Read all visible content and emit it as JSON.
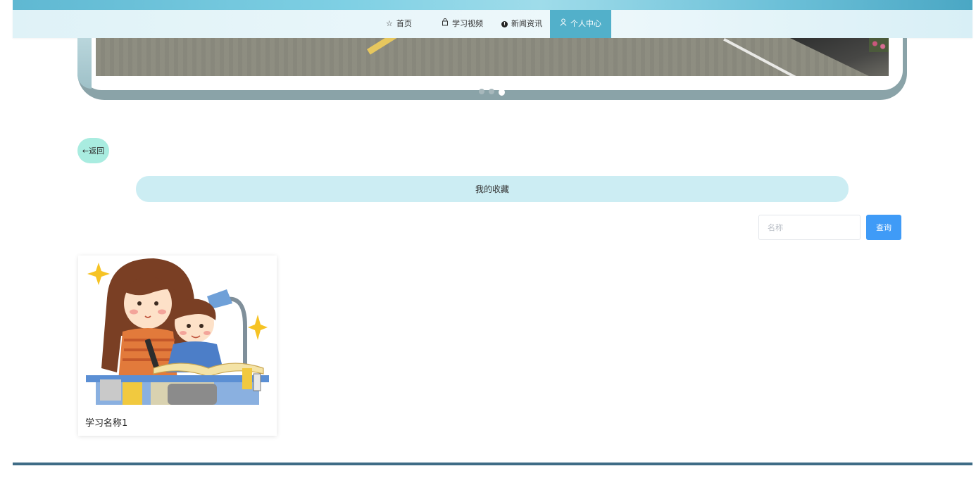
{
  "nav": {
    "items": [
      {
        "label": "首页",
        "icon": "star-outline-icon"
      },
      {
        "label": "学习视频",
        "icon": "bag-icon"
      },
      {
        "label": "新闻资讯",
        "icon": "info-circle-icon"
      },
      {
        "label": "个人中心",
        "icon": "user-icon",
        "active": true
      }
    ],
    "active_color": "#52b0ca"
  },
  "banner": {
    "dots": 3,
    "active_dot": 2
  },
  "back_button": {
    "label": "←返回"
  },
  "section": {
    "title": "我的收藏"
  },
  "search": {
    "placeholder": "名称",
    "value": "",
    "button_label": "查询",
    "button_color": "#3f9bf7"
  },
  "favorites": [
    {
      "title": "学习名称1",
      "image": "mother-and-child-reading-illustration"
    }
  ]
}
